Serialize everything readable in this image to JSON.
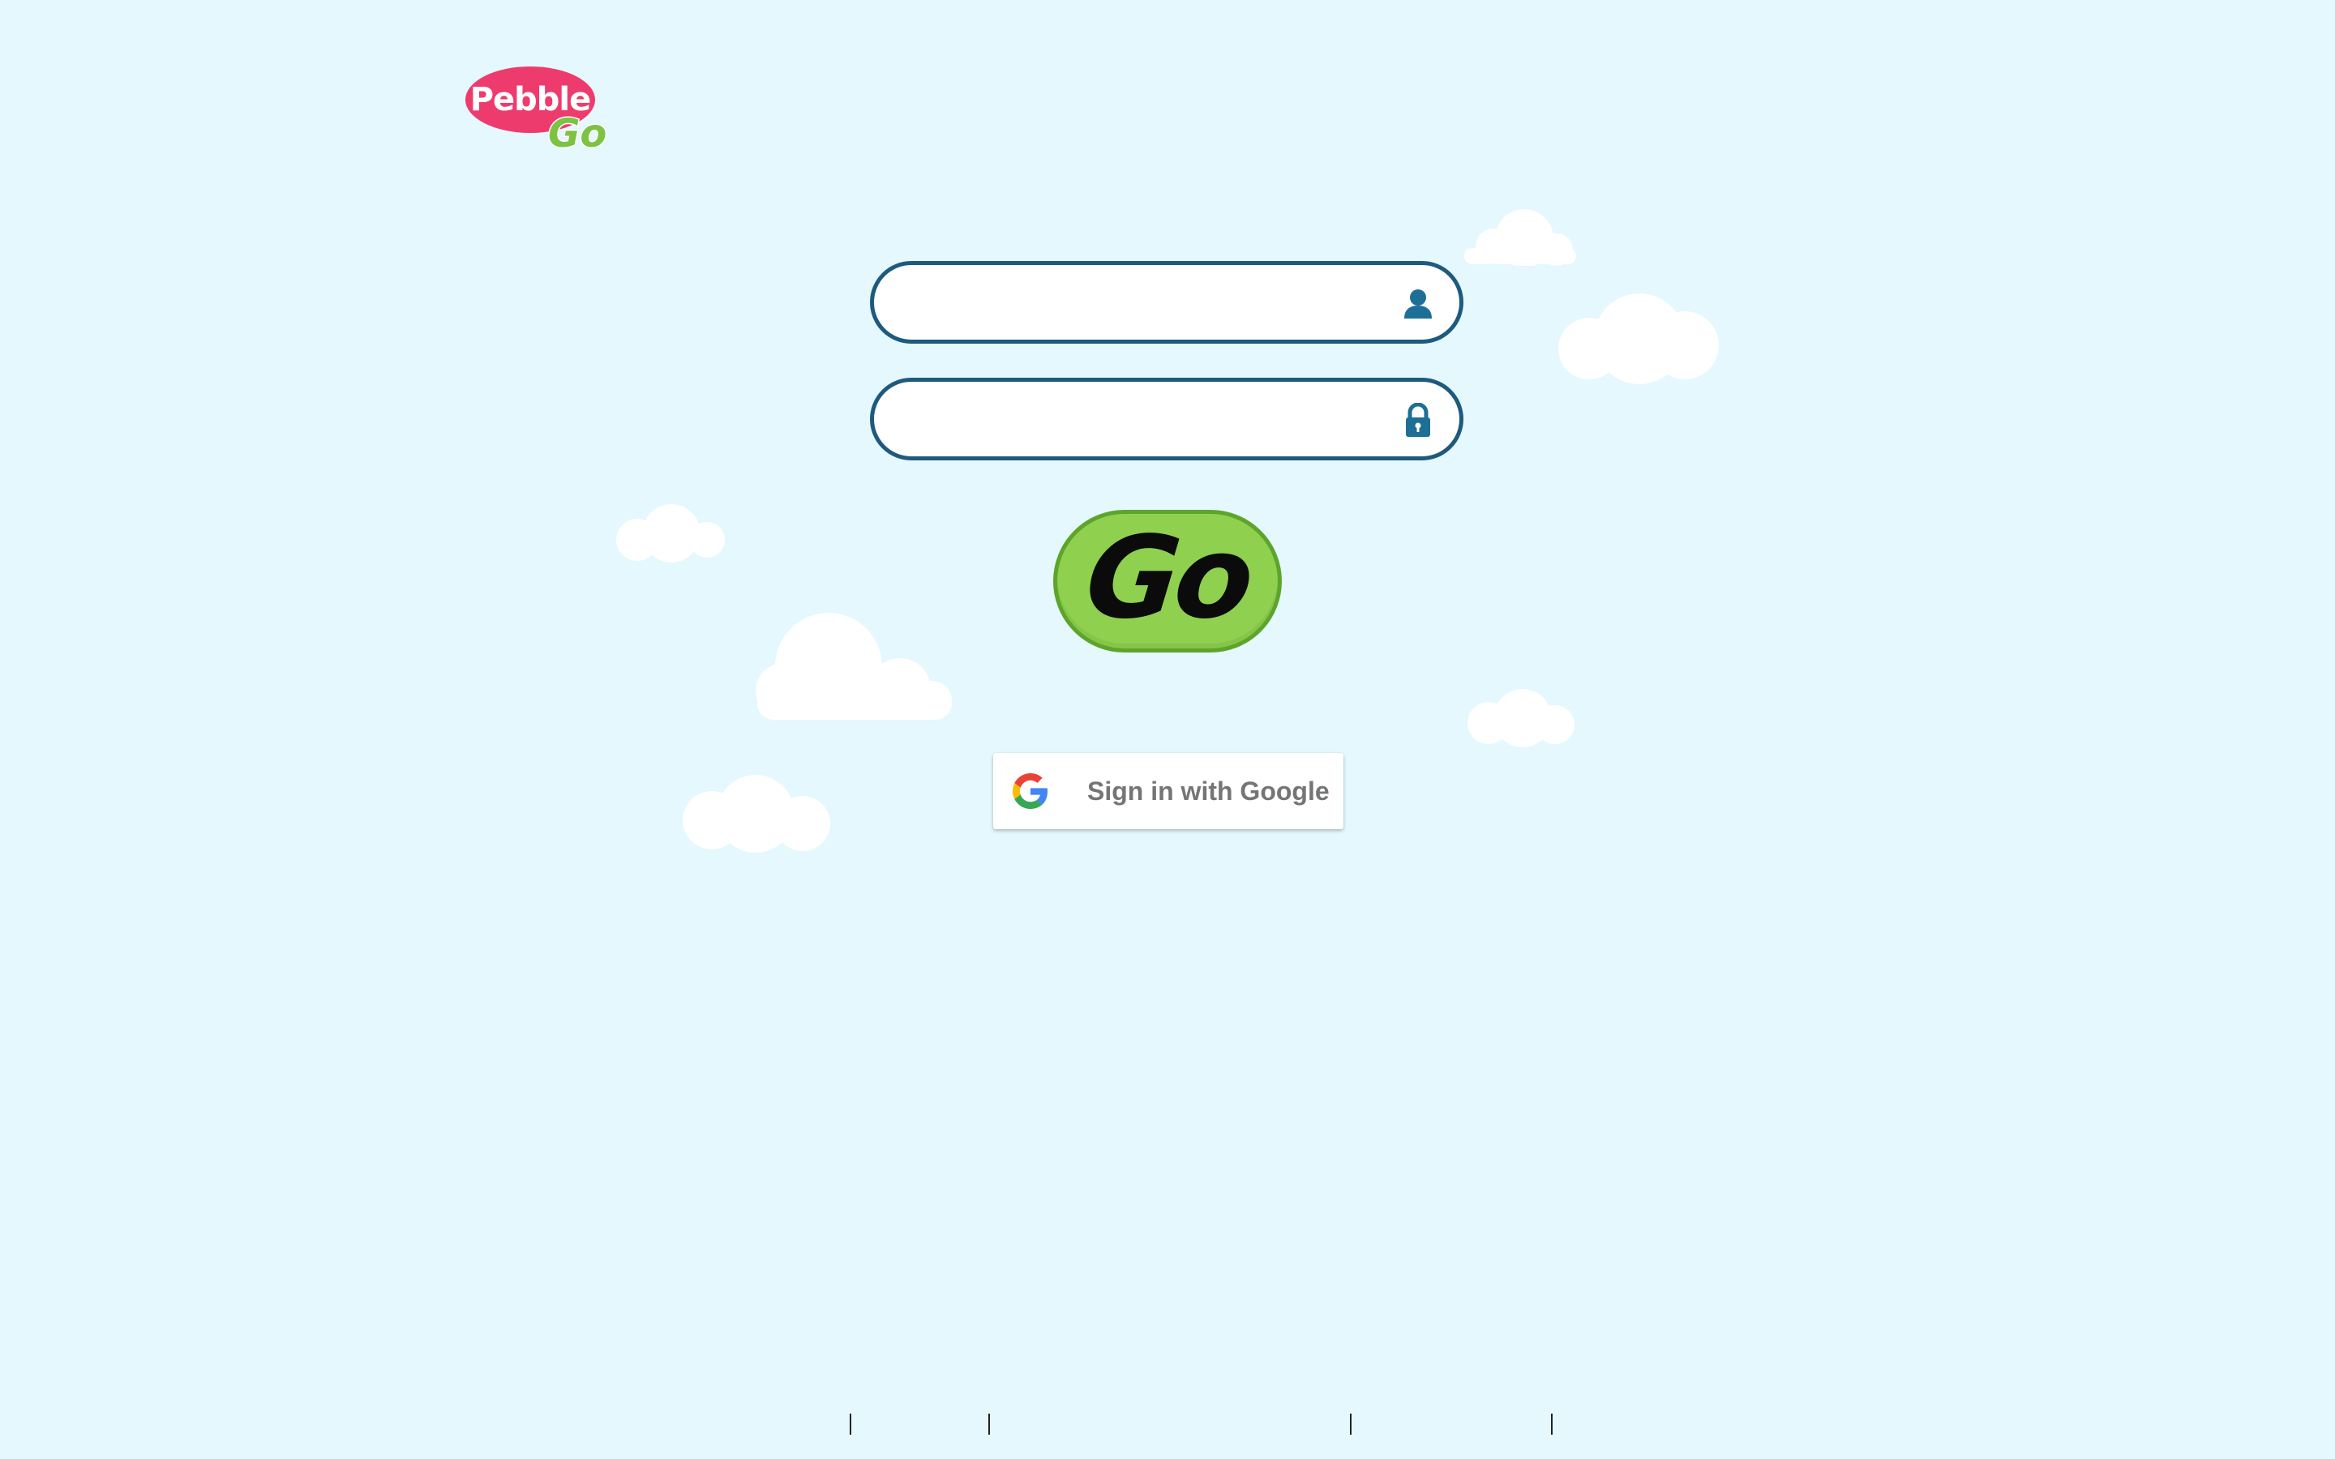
{
  "logo": {
    "pebble_text": "Pebble",
    "go_text": "Go",
    "pebble_color": "#ee3b6e",
    "go_color": "#7dc242"
  },
  "login_form": {
    "username": {
      "value": "",
      "placeholder": "",
      "icon": "user-icon"
    },
    "password": {
      "value": "",
      "placeholder": "",
      "icon": "lock-icon"
    },
    "go_button_label": "Go",
    "google_button_label": "Sign in with Google",
    "google_icon": "google-g-icon"
  },
  "colors": {
    "background": "#e4f8fd",
    "field_border": "#1e5a7e",
    "go_button": "#8fd14f",
    "go_button_border": "#5da52a"
  },
  "footer": {
    "links": []
  }
}
